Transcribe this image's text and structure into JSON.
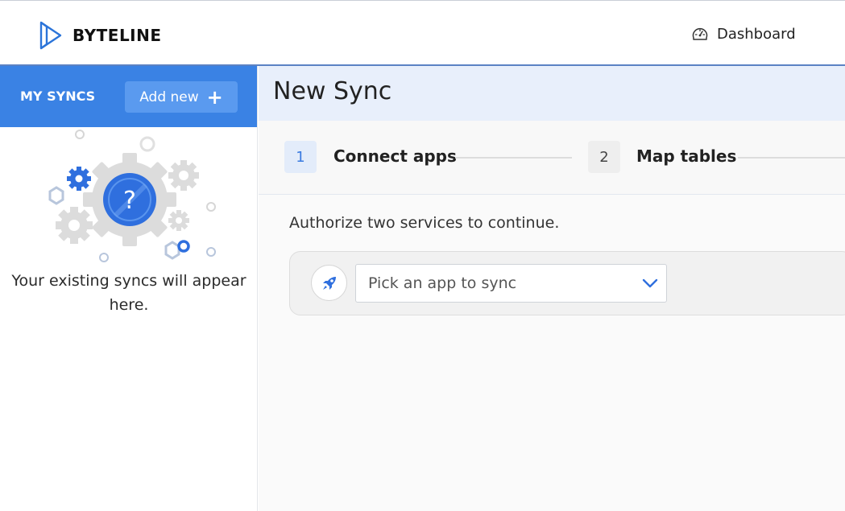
{
  "header": {
    "brand": "BYTELINE",
    "dashboard_label": "Dashboard"
  },
  "sidebar": {
    "title": "MY SYNCS",
    "add_new_label": "Add new",
    "empty_message": "Your existing syncs will appear here."
  },
  "main": {
    "title": "New Sync",
    "steps": [
      {
        "number": "1",
        "label": "Connect apps"
      },
      {
        "number": "2",
        "label": "Map tables"
      }
    ],
    "instructions": "Authorize two services to continue.",
    "app_picker": {
      "placeholder": "Pick an app to sync"
    }
  },
  "colors": {
    "accent": "#3a82e4",
    "accent_light": "#5a9aef",
    "header_tint": "#e8effb"
  },
  "icons": {
    "logo": "byteline-logo-icon",
    "dashboard": "speedometer-icon",
    "add": "plus-icon",
    "illustration": "gears-question-icon",
    "app": "rocket-icon",
    "dropdown": "chevron-down-icon"
  }
}
